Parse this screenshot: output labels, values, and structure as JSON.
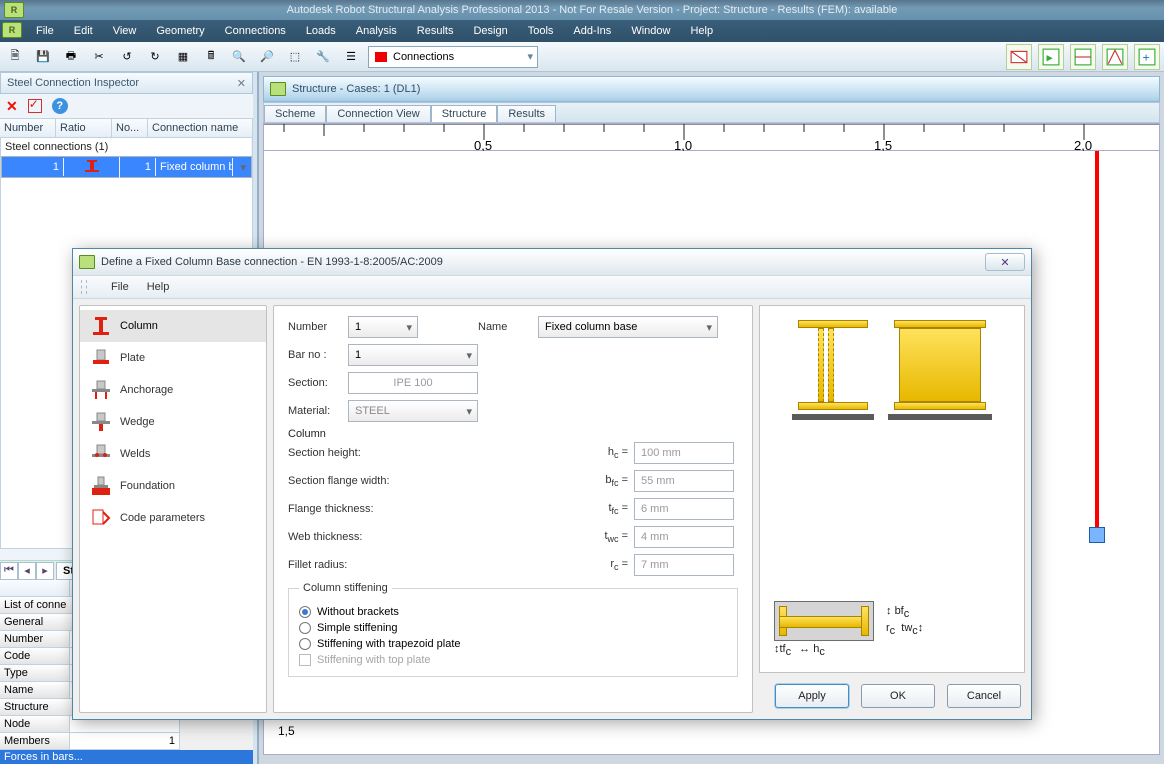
{
  "titlebar": {
    "title": "Autodesk Robot Structural Analysis Professional 2013 - Not For Resale Version - Project: Structure - Results (FEM): available"
  },
  "menu": [
    "File",
    "Edit",
    "View",
    "Geometry",
    "Connections",
    "Loads",
    "Analysis",
    "Results",
    "Design",
    "Tools",
    "Add-Ins",
    "Window",
    "Help"
  ],
  "toolbar": {
    "combo_label": "Connections"
  },
  "inspector": {
    "title": "Steel Connection Inspector",
    "columns": [
      "Number",
      "Ratio",
      "No...",
      "Connection name"
    ],
    "group_label": "Steel connections (1)",
    "row": {
      "number": "1",
      "ratio_iconcolor": "#e02010",
      "no": "1",
      "name": "Fixed column base"
    }
  },
  "bottom": {
    "tab": "Stee",
    "header": "Name",
    "section1": "List of conne",
    "section2": "General",
    "rows": [
      {
        "k": "Number",
        "v": ""
      },
      {
        "k": "Code",
        "v": ""
      },
      {
        "k": "Type",
        "v": ""
      },
      {
        "k": "Name",
        "v": ""
      }
    ],
    "section3": "Structure",
    "rows2": [
      {
        "k": "Node",
        "v": ""
      },
      {
        "k": "Members",
        "v": "1"
      }
    ],
    "footer": "Forces in bars..."
  },
  "canvas": {
    "subtitle": "Structure - Cases: 1 (DL1)",
    "tabs": [
      "Scheme",
      "Connection View",
      "Structure",
      "Results"
    ],
    "active_tab": 2,
    "ruler_ticks": [
      "0,5",
      "1,0",
      "1,5",
      "2,0"
    ],
    "vticks": [
      "1,5"
    ]
  },
  "dialog": {
    "title": "Define a Fixed Column Base connection - EN 1993-1-8:2005/AC:2009",
    "menu": [
      "File",
      "Help"
    ],
    "nav": [
      "Column",
      "Plate",
      "Anchorage",
      "Wedge",
      "Welds",
      "Foundation",
      "Code parameters"
    ],
    "nav_active": 0,
    "form": {
      "number_lbl": "Number",
      "number": "1",
      "name_lbl": "Name",
      "name": "Fixed column base",
      "barno_lbl": "Bar no :",
      "barno": "1",
      "section_lbl": "Section:",
      "section": "IPE 100",
      "material_lbl": "Material:",
      "material": "STEEL",
      "column_head": "Column",
      "dims": [
        {
          "label": "Section height:",
          "sym": "h",
          "sub": "c",
          "val": "100 mm"
        },
        {
          "label": "Section flange width:",
          "sym": "b",
          "sub": "fc",
          "val": "55 mm"
        },
        {
          "label": "Flange thickness:",
          "sym": "t",
          "sub": "fc",
          "val": "6 mm"
        },
        {
          "label": "Web thickness:",
          "sym": "t",
          "sub": "wc",
          "val": "4 mm"
        },
        {
          "label": "Fillet radius:",
          "sym": "r",
          "sub": "c",
          "val": "7 mm"
        }
      ],
      "stiff_head": "Column stiffening",
      "radios": [
        "Without brackets",
        "Simple stiffening",
        "Stiffening with trapezoid plate"
      ],
      "radio_checked": 0,
      "chk": "Stiffening with top plate"
    },
    "preview_labels": {
      "rc": "r",
      "twc": "tw",
      "bfc": "bf",
      "tfc": "tf",
      "hc": "h"
    },
    "buttons": [
      "Apply",
      "OK",
      "Cancel"
    ]
  }
}
